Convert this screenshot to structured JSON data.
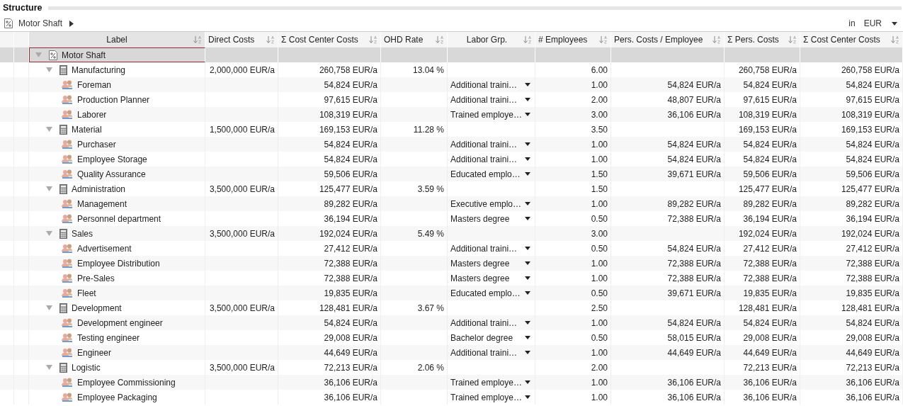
{
  "panel": {
    "title": "Structure"
  },
  "breadcrumb": {
    "label": "Motor Shaft"
  },
  "currency": {
    "prefix": "in",
    "value": "EUR"
  },
  "table": {
    "columns": [
      "Label",
      "Direct Costs",
      "Σ Cost Center Costs",
      "OHD Rate",
      "Labor Grp.",
      "# Employees",
      "Pers. Costs / Employee",
      "Σ Pers. Costs",
      "Σ Cost Center Costs"
    ],
    "rows": [
      {
        "kind": "root",
        "label": "Motor Shaft",
        "selected": true,
        "expanded": true,
        "children": [
          {
            "kind": "cost_center",
            "label": "Manufacturing",
            "selected": false,
            "expanded": true,
            "direct_costs": "2,000,000 EUR/a",
            "cc_costs": "260,758 EUR/a",
            "ohd_rate": "13.04 %",
            "employees": "6.00",
            "pers_costs": "260,758 EUR/a",
            "total_cc_costs": "260,758 EUR/a",
            "children": [
              {
                "kind": "position",
                "label": "Foreman",
                "selected": false,
                "cc_costs": "54,824 EUR/a",
                "labor_grp": "Additional traini…",
                "employees": "1.00",
                "pers_per_employee": "54,824 EUR/a",
                "pers_costs": "54,824 EUR/a",
                "total_cc_costs": "54,824 EUR/a"
              },
              {
                "kind": "position",
                "label": "Production Planner",
                "selected": false,
                "cc_costs": "97,615 EUR/a",
                "labor_grp": "Additional traini…",
                "employees": "2.00",
                "pers_per_employee": "48,807 EUR/a",
                "pers_costs": "97,615 EUR/a",
                "total_cc_costs": "97,615 EUR/a"
              },
              {
                "kind": "position",
                "label": "Laborer",
                "selected": false,
                "cc_costs": "108,319 EUR/a",
                "labor_grp": "Trained employe…",
                "employees": "3.00",
                "pers_per_employee": "36,106 EUR/a",
                "pers_costs": "108,319 EUR/a",
                "total_cc_costs": "108,319 EUR/a"
              }
            ]
          },
          {
            "kind": "cost_center",
            "label": "Material",
            "selected": false,
            "expanded": true,
            "direct_costs": "1,500,000 EUR/a",
            "cc_costs": "169,153 EUR/a",
            "ohd_rate": "11.28 %",
            "employees": "3.50",
            "pers_costs": "169,153 EUR/a",
            "total_cc_costs": "169,153 EUR/a",
            "children": [
              {
                "kind": "position",
                "label": "Purchaser",
                "selected": false,
                "cc_costs": "54,824 EUR/a",
                "labor_grp": "Additional traini…",
                "employees": "1.00",
                "pers_per_employee": "54,824 EUR/a",
                "pers_costs": "54,824 EUR/a",
                "total_cc_costs": "54,824 EUR/a"
              },
              {
                "kind": "position",
                "label": "Employee Storage",
                "selected": false,
                "cc_costs": "54,824 EUR/a",
                "labor_grp": "Additional traini…",
                "employees": "1.00",
                "pers_per_employee": "54,824 EUR/a",
                "pers_costs": "54,824 EUR/a",
                "total_cc_costs": "54,824 EUR/a"
              },
              {
                "kind": "position",
                "label": "Quality Assurance",
                "selected": false,
                "cc_costs": "59,506 EUR/a",
                "labor_grp": "Educated emplo…",
                "employees": "1.50",
                "pers_per_employee": "39,671 EUR/a",
                "pers_costs": "59,506 EUR/a",
                "total_cc_costs": "59,506 EUR/a"
              }
            ]
          },
          {
            "kind": "cost_center",
            "label": "Administration",
            "selected": false,
            "expanded": true,
            "direct_costs": "3,500,000 EUR/a",
            "cc_costs": "125,477 EUR/a",
            "ohd_rate": "3.59 %",
            "employees": "1.50",
            "pers_costs": "125,477 EUR/a",
            "total_cc_costs": "125,477 EUR/a",
            "children": [
              {
                "kind": "position",
                "label": "Management",
                "selected": false,
                "cc_costs": "89,282 EUR/a",
                "labor_grp": "Executive emplo…",
                "employees": "1.00",
                "pers_per_employee": "89,282 EUR/a",
                "pers_costs": "89,282 EUR/a",
                "total_cc_costs": "89,282 EUR/a"
              },
              {
                "kind": "position",
                "label": "Personnel department",
                "selected": false,
                "cc_costs": "36,194 EUR/a",
                "labor_grp": "Masters degree",
                "employees": "0.50",
                "pers_per_employee": "72,388 EUR/a",
                "pers_costs": "36,194 EUR/a",
                "total_cc_costs": "36,194 EUR/a"
              }
            ]
          },
          {
            "kind": "cost_center",
            "label": "Sales",
            "selected": false,
            "expanded": true,
            "direct_costs": "3,500,000 EUR/a",
            "cc_costs": "192,024 EUR/a",
            "ohd_rate": "5.49 %",
            "employees": "3.00",
            "pers_costs": "192,024 EUR/a",
            "total_cc_costs": "192,024 EUR/a",
            "children": [
              {
                "kind": "position",
                "label": "Advertisement",
                "selected": false,
                "cc_costs": "27,412 EUR/a",
                "labor_grp": "Additional traini…",
                "employees": "0.50",
                "pers_per_employee": "54,824 EUR/a",
                "pers_costs": "27,412 EUR/a",
                "total_cc_costs": "27,412 EUR/a"
              },
              {
                "kind": "position",
                "label": "Employee Distribution",
                "selected": false,
                "cc_costs": "72,388 EUR/a",
                "labor_grp": "Masters degree",
                "employees": "1.00",
                "pers_per_employee": "72,388 EUR/a",
                "pers_costs": "72,388 EUR/a",
                "total_cc_costs": "72,388 EUR/a"
              },
              {
                "kind": "position",
                "label": "Pre-Sales",
                "selected": false,
                "cc_costs": "72,388 EUR/a",
                "labor_grp": "Masters degree",
                "employees": "1.00",
                "pers_per_employee": "72,388 EUR/a",
                "pers_costs": "72,388 EUR/a",
                "total_cc_costs": "72,388 EUR/a"
              },
              {
                "kind": "position",
                "label": "Fleet",
                "selected": false,
                "cc_costs": "19,835 EUR/a",
                "labor_grp": "Educated emplo…",
                "employees": "0.50",
                "pers_per_employee": "39,671 EUR/a",
                "pers_costs": "19,835 EUR/a",
                "total_cc_costs": "19,835 EUR/a"
              }
            ]
          },
          {
            "kind": "cost_center",
            "label": "Development",
            "selected": false,
            "expanded": true,
            "direct_costs": "3,500,000 EUR/a",
            "cc_costs": "128,481 EUR/a",
            "ohd_rate": "3.67 %",
            "employees": "2.50",
            "pers_costs": "128,481 EUR/a",
            "total_cc_costs": "128,481 EUR/a",
            "children": [
              {
                "kind": "position",
                "label": "Development engineer",
                "selected": false,
                "cc_costs": "54,824 EUR/a",
                "labor_grp": "Additional traini…",
                "employees": "1.00",
                "pers_per_employee": "54,824 EUR/a",
                "pers_costs": "54,824 EUR/a",
                "total_cc_costs": "54,824 EUR/a"
              },
              {
                "kind": "position",
                "label": "Testing engineer",
                "selected": false,
                "cc_costs": "29,008 EUR/a",
                "labor_grp": "Bachelor degree",
                "employees": "0.50",
                "pers_per_employee": "58,015 EUR/a",
                "pers_costs": "29,008 EUR/a",
                "total_cc_costs": "29,008 EUR/a"
              },
              {
                "kind": "position",
                "label": "Engineer",
                "selected": false,
                "cc_costs": "44,649 EUR/a",
                "labor_grp": "Additional traini…",
                "employees": "1.00",
                "pers_per_employee": "44,649 EUR/a",
                "pers_costs": "44,649 EUR/a",
                "total_cc_costs": "44,649 EUR/a"
              }
            ]
          },
          {
            "kind": "cost_center",
            "label": "Logistic",
            "selected": false,
            "expanded": true,
            "direct_costs": "3,500,000 EUR/a",
            "cc_costs": "72,213 EUR/a",
            "ohd_rate": "2.06 %",
            "employees": "2.00",
            "pers_costs": "72,213 EUR/a",
            "total_cc_costs": "72,213 EUR/a",
            "children": [
              {
                "kind": "position",
                "label": "Employee Commissioning",
                "selected": false,
                "cc_costs": "36,106 EUR/a",
                "labor_grp": "Trained employe…",
                "employees": "1.00",
                "pers_per_employee": "36,106 EUR/a",
                "pers_costs": "36,106 EUR/a",
                "total_cc_costs": "36,106 EUR/a"
              },
              {
                "kind": "position",
                "label": "Employee Packaging",
                "selected": false,
                "cc_costs": "36,106 EUR/a",
                "labor_grp": "Trained employe…",
                "employees": "1.00",
                "pers_per_employee": "36,106 EUR/a",
                "pers_costs": "36,106 EUR/a",
                "total_cc_costs": "36,106 EUR/a"
              }
            ]
          }
        ]
      }
    ]
  }
}
